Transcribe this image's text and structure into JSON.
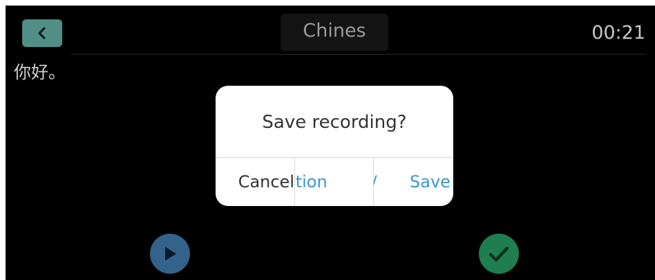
{
  "header": {
    "title": "Chines",
    "timer": "00:21",
    "back_icon": "chevron-left-icon"
  },
  "transcript": {
    "text": "你好。"
  },
  "dialog": {
    "title": "Save recording?",
    "actions": {
      "cancel": "Cancel",
      "mid_fragment": "ation",
      "third_fragment": "T/",
      "save": "Save"
    }
  },
  "controls": {
    "play_icon": "play-icon",
    "confirm_icon": "checkmark-icon"
  },
  "colors": {
    "background": "#000000",
    "back_button": "#4f8f86",
    "accent_blue": "#3b95cf",
    "play_button": "#33628b",
    "confirm_button": "#1e7e4f"
  }
}
